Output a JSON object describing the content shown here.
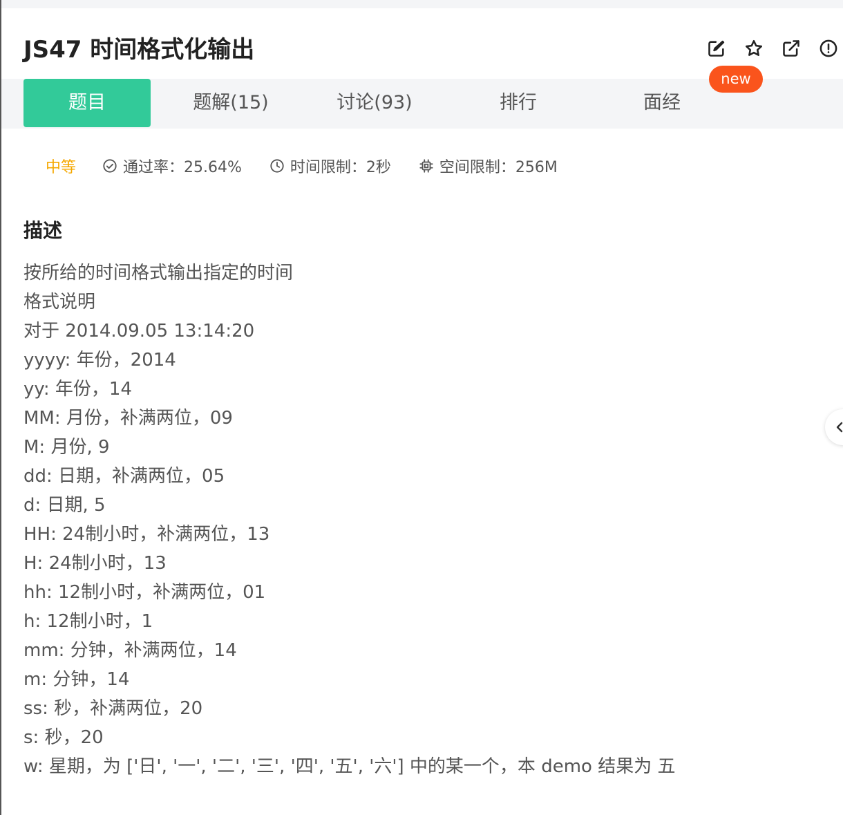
{
  "problem": {
    "title": "JS47  时间格式化输出"
  },
  "header_icons": [
    "edit-icon",
    "star-icon",
    "external-link-icon",
    "report-icon"
  ],
  "badge": {
    "new_label": "new",
    "color": "#fa541c"
  },
  "tabs": [
    {
      "label": "题目",
      "active": true
    },
    {
      "label": "题解(15)",
      "active": false
    },
    {
      "label": "讨论(93)",
      "active": false
    },
    {
      "label": "排行",
      "active": false
    },
    {
      "label": "面经",
      "active": false
    }
  ],
  "meta": {
    "difficulty": "中等",
    "pass_rate": "通过率：25.64%",
    "time_limit": "时间限制：2秒",
    "memory_limit": "空间限制：256M"
  },
  "description": {
    "heading": "描述",
    "lines": [
      "按所给的时间格式输出指定的时间",
      "格式说明",
      "对于 2014.09.05 13:14:20",
      "yyyy: 年份，2014",
      "yy: 年份，14",
      "MM: 月份，补满两位，09",
      "M: 月份, 9",
      "dd: 日期，补满两位，05",
      "d: 日期, 5",
      "HH: 24制小时，补满两位，13",
      "H: 24制小时，13",
      "hh: 12制小时，补满两位，01",
      "h: 12制小时，1",
      "mm: 分钟，补满两位，14",
      "m: 分钟，14",
      "ss: 秒，补满两位，20",
      "s: 秒，20",
      "w: 星期，为 ['日', '一', '二', '三', '四', '五', '六'] 中的某一个，本 demo 结果为 五"
    ]
  },
  "colors": {
    "accent": "#32ca99",
    "difficulty": "#f5a800",
    "tab_bar_bg": "#f4f5f7"
  }
}
